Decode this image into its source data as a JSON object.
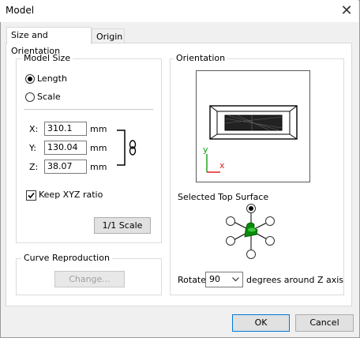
{
  "window": {
    "title": "Model"
  },
  "tabs": [
    {
      "label": "Size and Orientation",
      "active": true
    },
    {
      "label": "Origin",
      "active": false
    }
  ],
  "model_size": {
    "legend": "Model Size",
    "options": [
      {
        "label": "Length",
        "selected": true
      },
      {
        "label": "Scale",
        "selected": false
      }
    ],
    "fields": [
      {
        "label": "X:",
        "value": "310.1",
        "unit": "mm"
      },
      {
        "label": "Y:",
        "value": "130.04",
        "unit": "mm"
      },
      {
        "label": "Z:",
        "value": "38.07",
        "unit": "mm"
      }
    ],
    "keep_ratio": {
      "label": "Keep XYZ ratio",
      "checked": true
    },
    "scale_button": "1/1 Scale",
    "link_icon": "chain-link-icon"
  },
  "curve": {
    "legend": "Curve Reproduction",
    "change_button": "Change...",
    "change_enabled": false
  },
  "orientation": {
    "legend": "Orientation",
    "preview_axes": {
      "y": "y",
      "x": "x"
    },
    "selected_top_surface_label": "Selected Top Surface",
    "selected_surface": "top",
    "rotate_label": "Rotate",
    "rotate_value": "90",
    "rotate_suffix": "degrees around Z axis"
  },
  "footer": {
    "ok": "OK",
    "cancel": "Cancel"
  },
  "colors": {
    "accent": "#0a8a0a",
    "axis_x": "#e02020",
    "axis_y": "#10a010"
  }
}
